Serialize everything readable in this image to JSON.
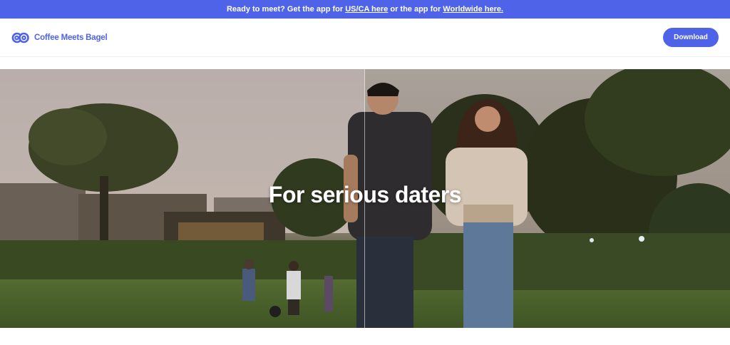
{
  "promo": {
    "text_before": "Ready to meet? Get the app for ",
    "link_uscanada": "US/CA here",
    "text_middle": " or the app for ",
    "link_worldwide": "Worldwide here.",
    "background_color": "#4f63e8"
  },
  "header": {
    "logo_text": "Coffee Meets Bagel",
    "logo_icon": "cmb-logo-icon",
    "download_label": "Download",
    "brand_color": "#4f63e8"
  },
  "hero": {
    "title": "For serious daters"
  }
}
